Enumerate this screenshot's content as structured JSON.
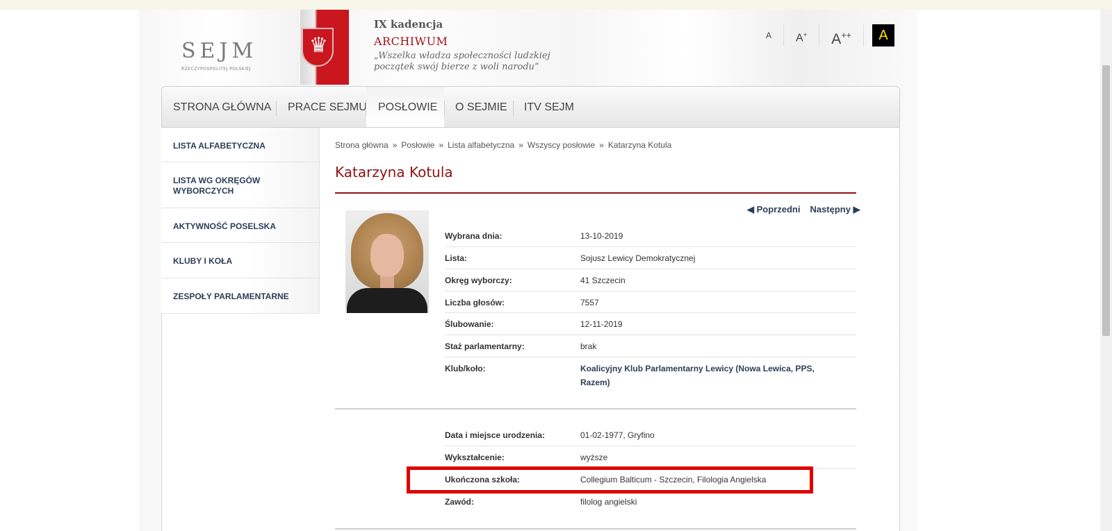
{
  "header": {
    "logo_text": "SEJM",
    "logo_sub": "RZECZYPOSPOLITEJ POLSKIEJ",
    "kadencja": "IX kadencja",
    "archiwum": "ARCHIWUM",
    "motto_line1": "„Wszelka władza społeczności ludzkiej",
    "motto_line2": "początek swój bierze z woli narodu”"
  },
  "font_controls": {
    "small": "A",
    "medium": "A+",
    "large": "A++",
    "contrast": "A"
  },
  "nav": {
    "items": [
      "STRONA GŁÓWNA",
      "PRACE SEJMU",
      "POSŁOWIE",
      "O SEJMIE",
      "ITV SEJM"
    ],
    "active_index": 2
  },
  "sidebar": {
    "items": [
      "LISTA ALFABETYCZNA",
      "LISTA WG OKRĘGÓW WYBORCZYCH",
      "AKTYWNOŚĆ POSELSKA",
      "KLUBY I KOŁA",
      "ZESPOŁY PARLAMENTARNE"
    ]
  },
  "breadcrumb": [
    "Strona główna",
    "Posłowie",
    "Lista alfabetyczna",
    "Wszyscy posłowie",
    "Katarzyna Kotula"
  ],
  "breadcrumb_separator": "»",
  "profile": {
    "name": "Katarzyna Kotula",
    "prev": "◀ Poprzedni",
    "next": "Następny ▶",
    "details": [
      {
        "label": "Wybrana dnia:",
        "value": "13-10-2019"
      },
      {
        "label": "Lista:",
        "value": "Sojusz Lewicy Demokratycznej"
      },
      {
        "label": "Okręg wyborczy:",
        "value": "41  Szczecin"
      },
      {
        "label": "Liczba głosów:",
        "value": "7557"
      },
      {
        "label": "Ślubowanie:",
        "value": "12-11-2019"
      },
      {
        "label": "Staż parlamentarny:",
        "value": "brak"
      },
      {
        "label": "Klub/koło:",
        "value": "Koalicyjny Klub Parlamentarny Lewicy (Nowa Lewica, PPS, Razem)"
      }
    ],
    "personal": [
      {
        "label": "Data i miejsce urodzenia:",
        "value": "01-02-1977, Gryfino"
      },
      {
        "label": "Wykształcenie:",
        "value": "wyższe"
      },
      {
        "label": "Ukończona szkoła:",
        "value": "Collegium Balticum - Szczecin, Filologia Angielska"
      },
      {
        "label": "Zawód:",
        "value": "filolog angielski"
      }
    ]
  },
  "colors": {
    "accent_red": "#8e1217",
    "link_navy": "#2c3e57",
    "highlight": "#e00000"
  }
}
